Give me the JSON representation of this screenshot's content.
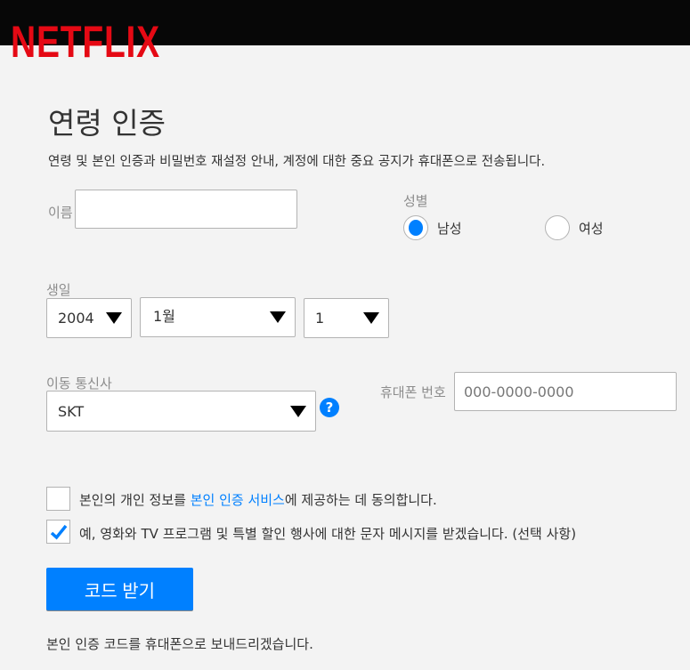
{
  "brand": {
    "logo": "NETFLIX",
    "color": "#e50914"
  },
  "page": {
    "title": "연령 인증",
    "subtitle": "연령 및 본인 인증과 비밀번호 재설정 안내, 계정에 대한 중요 공지가 휴대폰으로 전송됩니다."
  },
  "form": {
    "name_label": "이름",
    "name_value": "",
    "gender_label": "성별",
    "gender_options": [
      "남성",
      "여성"
    ],
    "gender_selected": "남성",
    "birth_label": "생일",
    "year": "2004",
    "month": "1월",
    "day": "1",
    "carrier_label": "이동 통신사",
    "carrier": "SKT",
    "help_icon": "question-icon",
    "phone_label": "휴대폰 번호",
    "phone_placeholder": "000-0000-0000",
    "consent": {
      "prefix": "본인의 개인 정보를 ",
      "link": "본인 인증 서비스",
      "suffix": "에 제공하는 데 동의합니다.",
      "checked": false
    },
    "marketing": {
      "text": "예, 영화와 TV 프로그램 및 특별 할인 행사에 대한 문자 메시지를 받겠습니다. (선택 사항)",
      "checked": true
    },
    "submit_label": "코드 받기",
    "footnote": "본인 인증 코드를 휴대폰으로 보내드리겠습니다."
  },
  "colors": {
    "accent": "#0080ff"
  }
}
